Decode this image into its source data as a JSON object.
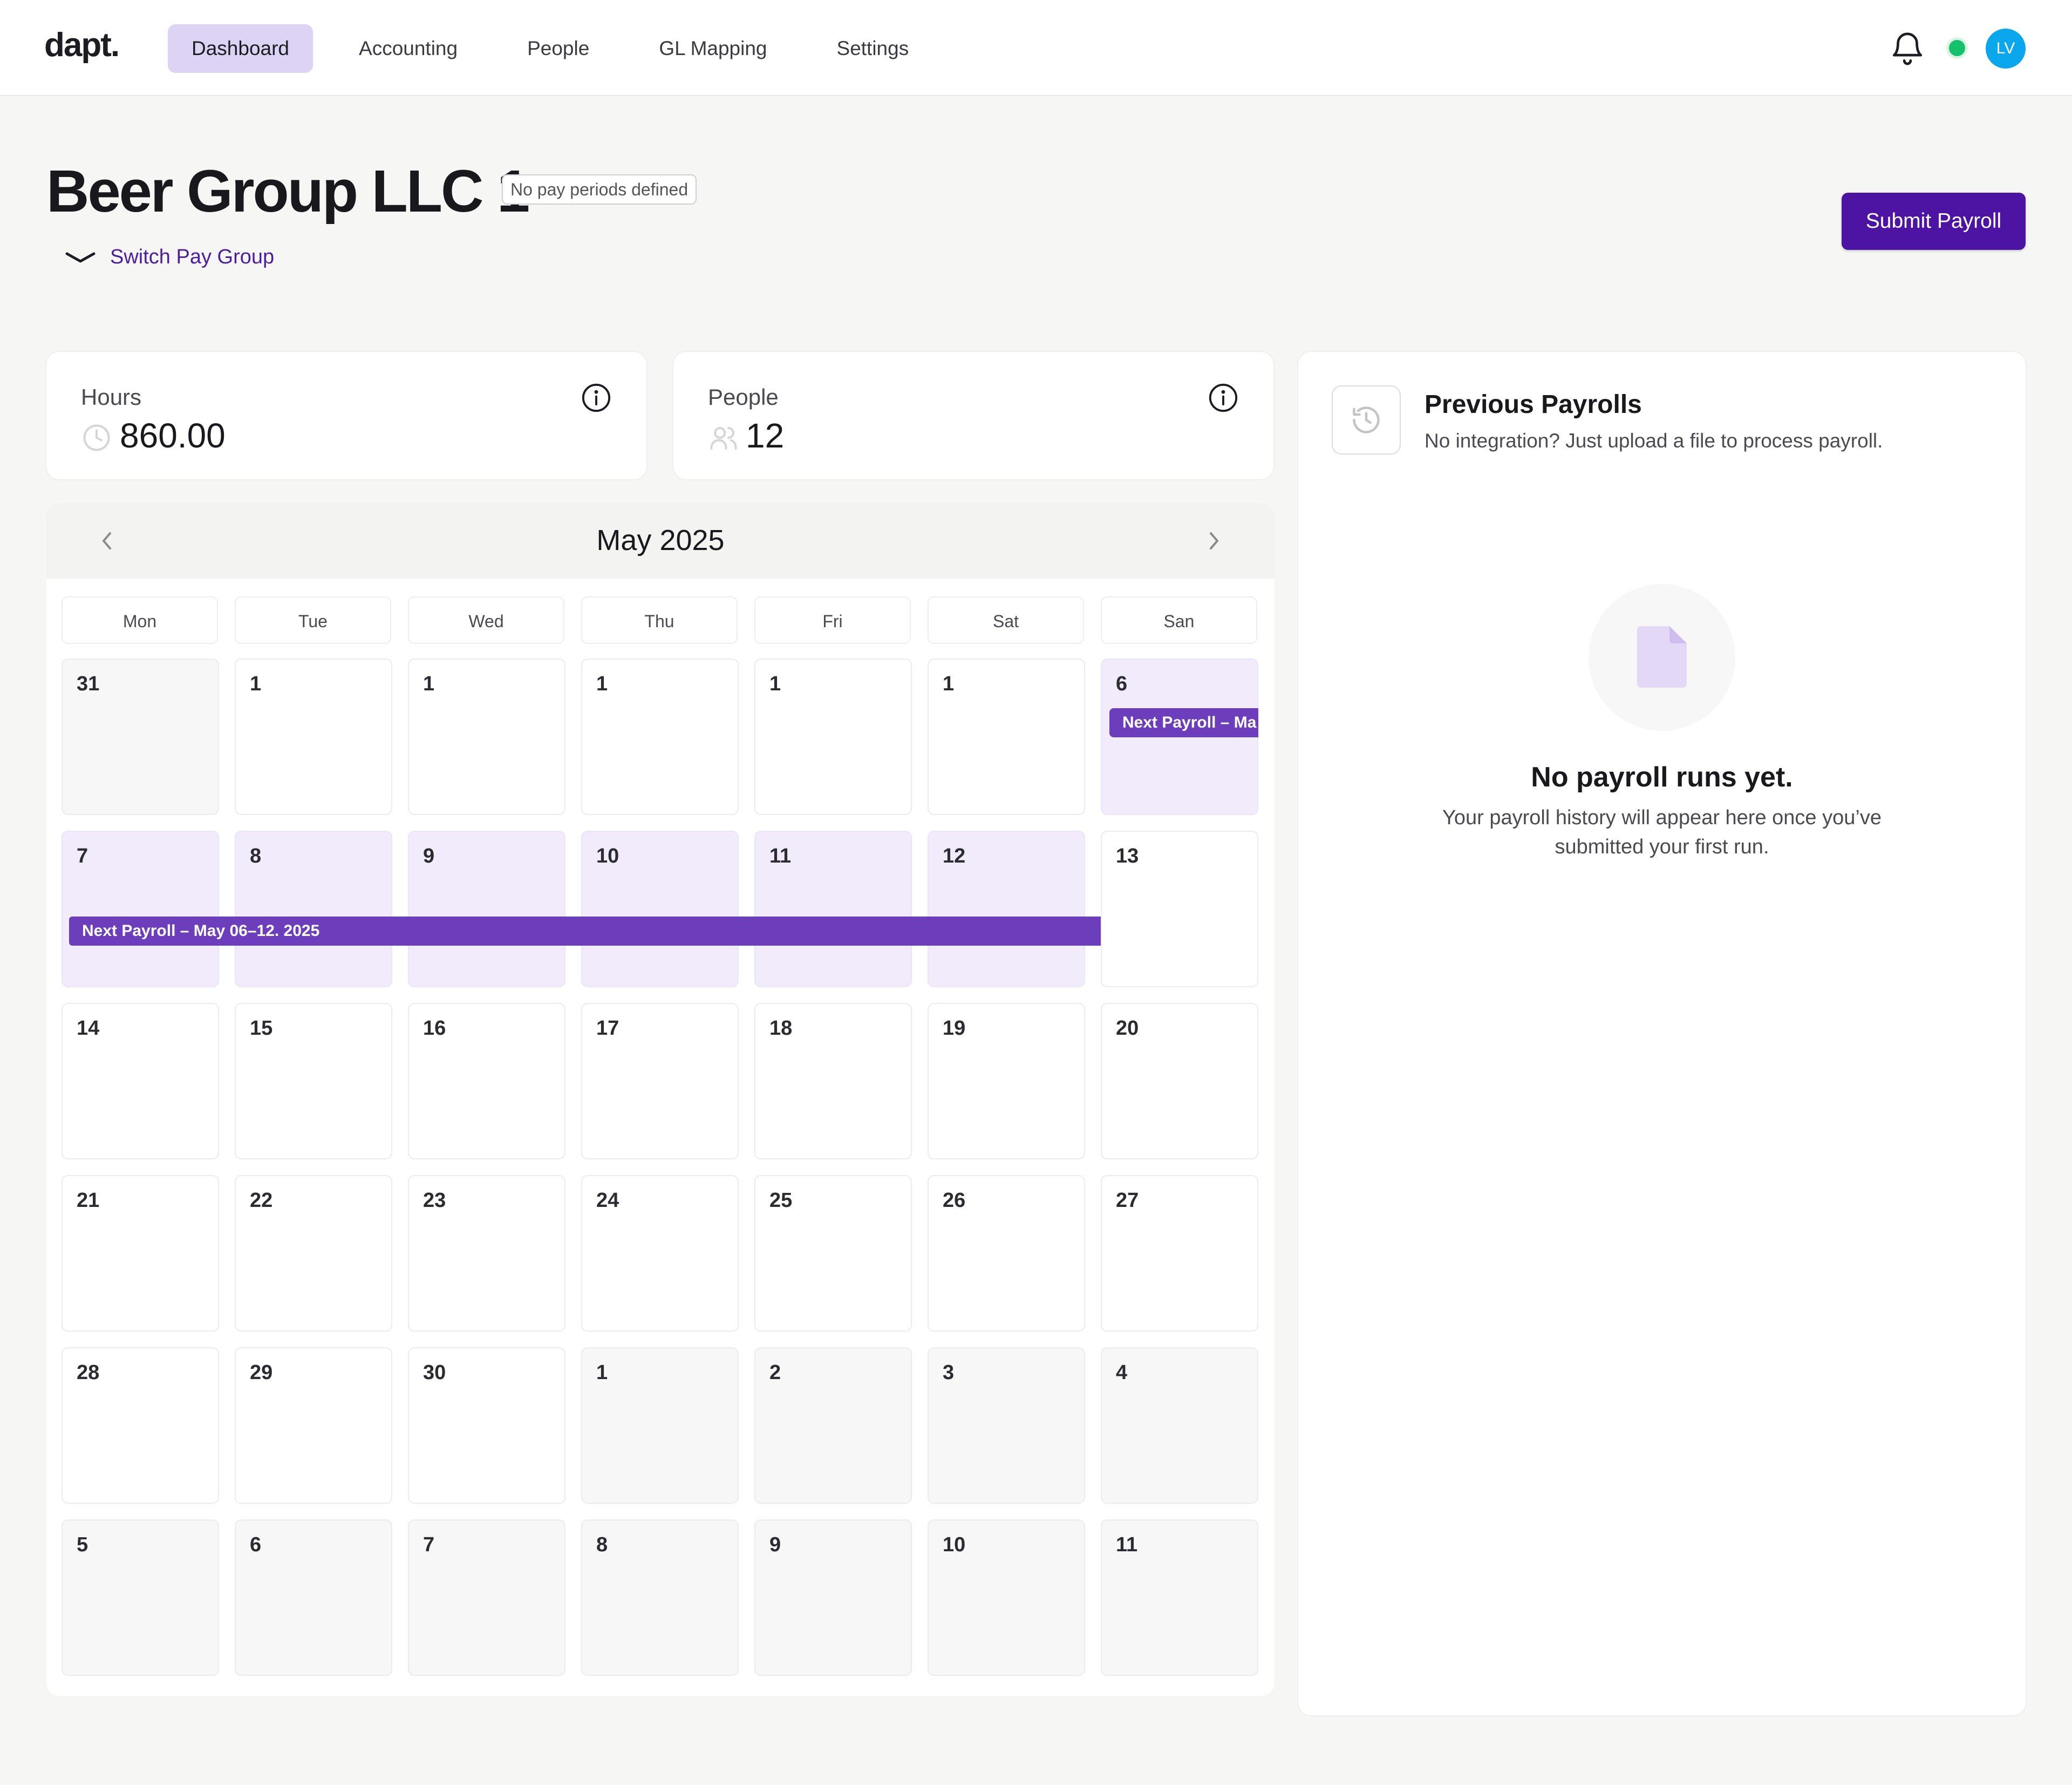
{
  "app": {
    "logo": "dapt."
  },
  "nav": {
    "items": [
      {
        "label": "Dashboard",
        "active": true
      },
      {
        "label": "Accounting",
        "active": false
      },
      {
        "label": "People",
        "active": false
      },
      {
        "label": "GL Mapping",
        "active": false
      },
      {
        "label": "Settings",
        "active": false
      }
    ]
  },
  "header": {
    "avatar_initials": "LV",
    "status_color": "#15c16b",
    "avatar_color": "#0aa7ec"
  },
  "page": {
    "title": "Beer Group LLC 1",
    "pay_period_badge": "No pay periods defined",
    "switch_label": "Switch Pay Group",
    "submit_label": "Submit Payroll"
  },
  "stats": {
    "hours": {
      "label": "Hours",
      "value": "860.00",
      "icon": "clock-icon"
    },
    "people": {
      "label": "People",
      "value": "12",
      "icon": "users-icon"
    }
  },
  "calendar": {
    "month_label": "May 2025",
    "weekdays": [
      "Mon",
      "Tue",
      "Wed",
      "Thu",
      "Fri",
      "Sat",
      "San"
    ],
    "weeks": [
      [
        {
          "n": "31",
          "s": "muted"
        },
        {
          "n": "1",
          "s": "normal"
        },
        {
          "n": "1",
          "s": "normal"
        },
        {
          "n": "1",
          "s": "normal"
        },
        {
          "n": "1",
          "s": "normal"
        },
        {
          "n": "1",
          "s": "normal"
        },
        {
          "n": "6",
          "s": "highlight"
        }
      ],
      [
        {
          "n": "7",
          "s": "highlight"
        },
        {
          "n": "8",
          "s": "highlight"
        },
        {
          "n": "9",
          "s": "highlight"
        },
        {
          "n": "10",
          "s": "highlight"
        },
        {
          "n": "11",
          "s": "highlight"
        },
        {
          "n": "12",
          "s": "highlight"
        },
        {
          "n": "13",
          "s": "normal"
        }
      ],
      [
        {
          "n": "14",
          "s": "normal"
        },
        {
          "n": "15",
          "s": "normal"
        },
        {
          "n": "16",
          "s": "normal"
        },
        {
          "n": "17",
          "s": "normal"
        },
        {
          "n": "18",
          "s": "normal"
        },
        {
          "n": "19",
          "s": "normal"
        },
        {
          "n": "20",
          "s": "normal"
        }
      ],
      [
        {
          "n": "21",
          "s": "normal"
        },
        {
          "n": "22",
          "s": "normal"
        },
        {
          "n": "23",
          "s": "normal"
        },
        {
          "n": "24",
          "s": "normal"
        },
        {
          "n": "25",
          "s": "normal"
        },
        {
          "n": "26",
          "s": "normal"
        },
        {
          "n": "27",
          "s": "normal"
        }
      ],
      [
        {
          "n": "28",
          "s": "normal"
        },
        {
          "n": "29",
          "s": "normal"
        },
        {
          "n": "30",
          "s": "normal"
        },
        {
          "n": "1",
          "s": "muted"
        },
        {
          "n": "2",
          "s": "muted"
        },
        {
          "n": "3",
          "s": "muted"
        },
        {
          "n": "4",
          "s": "muted"
        }
      ],
      [
        {
          "n": "5",
          "s": "muted"
        },
        {
          "n": "6",
          "s": "muted"
        },
        {
          "n": "7",
          "s": "muted"
        },
        {
          "n": "8",
          "s": "muted"
        },
        {
          "n": "9",
          "s": "muted"
        },
        {
          "n": "10",
          "s": "muted"
        },
        {
          "n": "11",
          "s": "muted"
        }
      ]
    ],
    "events": {
      "week1_label": "Next Payroll – Ma",
      "week2_label": "Next Payroll – May 06–12. 2025"
    },
    "colors": {
      "highlight": "#f1ebfb",
      "event": "#6c3ebb",
      "accent": "#4d13a3"
    }
  },
  "previous_payrolls": {
    "title": "Previous Payrolls",
    "subtitle": "No integration? Just upload a file to process payroll.",
    "empty_title": "No payroll runs yet.",
    "empty_desc": "Your payroll history will appear here once you’ve submitted your first run."
  }
}
